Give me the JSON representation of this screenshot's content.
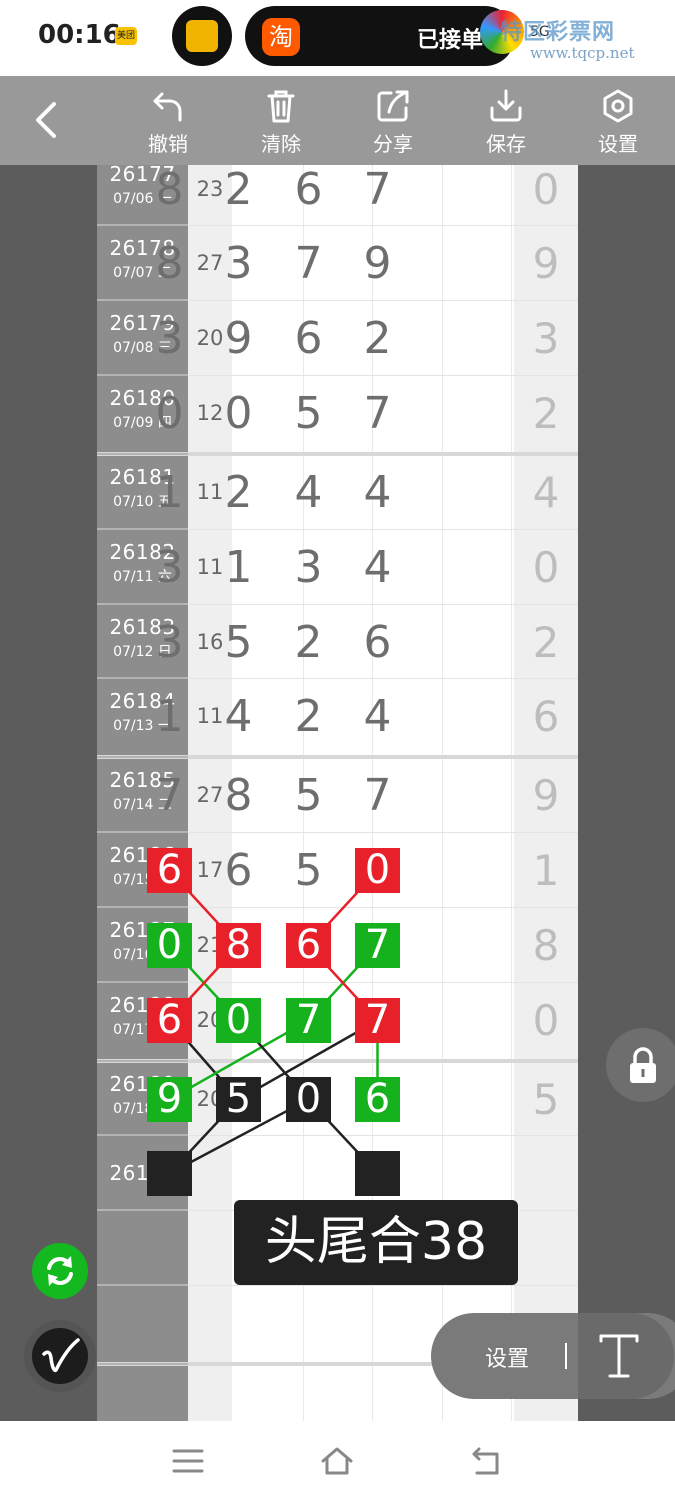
{
  "status_bar": {
    "time": "00:16",
    "meituan_badge": "美团",
    "taobao_glyph": "淘",
    "notification_text": "已接单",
    "signal_text": "5G",
    "watermark_text": "特区彩票网",
    "watermark_url": "www.tqcp.net"
  },
  "toolbar": {
    "undo_label": "撤销",
    "clear_label": "清除",
    "share_label": "分享",
    "save_label": "保存",
    "settings_label": "设置"
  },
  "rows": [
    {
      "issue": "26177",
      "date": "07/06 一",
      "sum": "23",
      "digits": [
        "8",
        "2",
        "6",
        "7"
      ],
      "tail": "0"
    },
    {
      "issue": "26178",
      "date": "07/07 二",
      "sum": "27",
      "digits": [
        "8",
        "3",
        "7",
        "9"
      ],
      "tail": "9"
    },
    {
      "issue": "26179",
      "date": "07/08 三",
      "sum": "20",
      "digits": [
        "3",
        "9",
        "6",
        "2"
      ],
      "tail": "3"
    },
    {
      "issue": "26180",
      "date": "07/09 四",
      "sum": "12",
      "digits": [
        "0",
        "0",
        "5",
        "7"
      ],
      "tail": "2"
    },
    {
      "issue": "26181",
      "date": "07/10 五",
      "sum": "11",
      "digits": [
        "1",
        "2",
        "4",
        "4"
      ],
      "tail": "4"
    },
    {
      "issue": "26182",
      "date": "07/11 六",
      "sum": "11",
      "digits": [
        "3",
        "1",
        "3",
        "4"
      ],
      "tail": "0"
    },
    {
      "issue": "26183",
      "date": "07/12 日",
      "sum": "16",
      "digits": [
        "3",
        "5",
        "2",
        "6"
      ],
      "tail": "2"
    },
    {
      "issue": "26184",
      "date": "07/13 一",
      "sum": "11",
      "digits": [
        "1",
        "4",
        "2",
        "4"
      ],
      "tail": "6"
    },
    {
      "issue": "26185",
      "date": "07/14 二",
      "sum": "27",
      "digits": [
        "7",
        "8",
        "5",
        "7"
      ],
      "tail": "9"
    },
    {
      "issue": "26186",
      "date": "07/15 三",
      "sum": "17",
      "digits": [
        "6",
        "6",
        "5",
        "0"
      ],
      "tail": "1"
    },
    {
      "issue": "26187",
      "date": "07/16 四",
      "sum": "21",
      "digits": [
        "0",
        "8",
        "6",
        "7"
      ],
      "tail": "8"
    },
    {
      "issue": "26188",
      "date": "07/17 五",
      "sum": "20",
      "digits": [
        "6",
        "0",
        "7",
        "7"
      ],
      "tail": "0"
    },
    {
      "issue": "26189",
      "date": "07/18 六",
      "sum": "20",
      "digits": [
        "9",
        "5",
        "0",
        "6"
      ],
      "tail": "5"
    },
    {
      "issue": "26190",
      "date": "",
      "sum": "",
      "digits": [
        "",
        "",
        "",
        ""
      ],
      "tail": ""
    }
  ],
  "marks": [
    {
      "row": 9,
      "col": 0,
      "color": "red"
    },
    {
      "row": 9,
      "col": 3,
      "color": "red"
    },
    {
      "row": 10,
      "col": 0,
      "color": "green"
    },
    {
      "row": 10,
      "col": 1,
      "color": "red"
    },
    {
      "row": 10,
      "col": 2,
      "color": "red"
    },
    {
      "row": 10,
      "col": 3,
      "color": "green"
    },
    {
      "row": 11,
      "col": 0,
      "color": "red"
    },
    {
      "row": 11,
      "col": 1,
      "color": "green"
    },
    {
      "row": 11,
      "col": 2,
      "color": "green"
    },
    {
      "row": 11,
      "col": 3,
      "color": "red"
    },
    {
      "row": 12,
      "col": 0,
      "color": "green"
    },
    {
      "row": 12,
      "col": 1,
      "color": "black"
    },
    {
      "row": 12,
      "col": 2,
      "color": "black"
    },
    {
      "row": 12,
      "col": 3,
      "color": "green"
    },
    {
      "row": 13,
      "col": 0,
      "color": "black"
    },
    {
      "row": 13,
      "col": 3,
      "color": "black"
    }
  ],
  "connectors": [
    {
      "from": [
        9,
        0
      ],
      "to": [
        10,
        1
      ],
      "color": "red"
    },
    {
      "from": [
        9,
        3
      ],
      "to": [
        10,
        2
      ],
      "color": "red"
    },
    {
      "from": [
        10,
        0
      ],
      "to": [
        11,
        1
      ],
      "color": "green"
    },
    {
      "from": [
        10,
        3
      ],
      "to": [
        11,
        2
      ],
      "color": "green"
    },
    {
      "from": [
        10,
        1
      ],
      "to": [
        11,
        0
      ],
      "color": "red"
    },
    {
      "from": [
        10,
        2
      ],
      "to": [
        11,
        3
      ],
      "color": "red"
    },
    {
      "from": [
        11,
        0
      ],
      "to": [
        12,
        1
      ],
      "color": "black"
    },
    {
      "from": [
        11,
        2
      ],
      "to": [
        12,
        0
      ],
      "color": "green"
    },
    {
      "from": [
        11,
        1
      ],
      "to": [
        12,
        2
      ],
      "color": "black"
    },
    {
      "from": [
        11,
        3
      ],
      "to": [
        12,
        1
      ],
      "color": "black"
    },
    {
      "from": [
        11,
        3
      ],
      "to": [
        12,
        3
      ],
      "color": "green"
    },
    {
      "from": [
        12,
        1
      ],
      "to": [
        13,
        0
      ],
      "color": "black"
    },
    {
      "from": [
        12,
        2
      ],
      "to": [
        13,
        0
      ],
      "color": "black"
    },
    {
      "from": [
        12,
        2
      ],
      "to": [
        13,
        3
      ],
      "color": "black"
    }
  ],
  "colors": {
    "red": "#e8202a",
    "green": "#15b21e",
    "black": "#222222"
  },
  "result_label": "头尾合38",
  "bottom_panel": {
    "settings_label": "设置",
    "text_tool_glyph": "T"
  },
  "icons": {
    "back": "chevron-left-icon",
    "undo": "undo-icon",
    "clear": "trash-icon",
    "share": "share-icon",
    "save": "download-icon",
    "settings": "hexagon-gear-icon",
    "lock": "lock-icon",
    "refresh": "refresh-icon",
    "pen": "pen-icon",
    "menu": "menu-icon",
    "home": "home-icon",
    "return": "return-icon"
  }
}
